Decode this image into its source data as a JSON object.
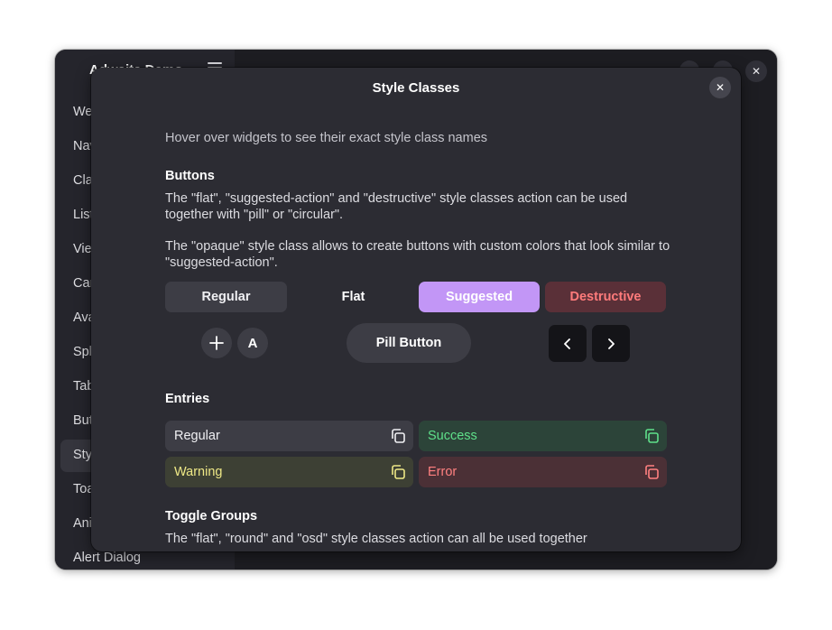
{
  "background_window": {
    "sidebar_title": "Adwaita Demo",
    "sidebar_items": [
      "Welcome",
      "Navigation View",
      "Clamp",
      "Lists",
      "View Switcher",
      "Carousel",
      "Avatar",
      "Split Views",
      "Tab View",
      "Buttons",
      "Style Classes",
      "Toasts",
      "Animations",
      "Alert Dialog"
    ],
    "selected_index": 10,
    "close_label": "✕"
  },
  "dialog": {
    "title": "Style Classes",
    "close_label": "✕",
    "hint": "Hover over widgets to see their exact style class names",
    "buttons_section": {
      "title": "Buttons",
      "para1": "The \"flat\", \"suggested-action\" and \"destructive\" style classes action can be used together with \"pill\" or \"circular\".",
      "para2": "The \"opaque\" style class allows to create buttons with custom colors that look similar to \"suggested-action\".",
      "regular": "Regular",
      "flat": "Flat",
      "suggested": "Suggested",
      "destructive": "Destructive",
      "circular_plus": "+",
      "circular_a": "A",
      "pill": "Pill Button"
    },
    "entries_section": {
      "title": "Entries",
      "regular": "Regular",
      "success": "Success",
      "warning": "Warning",
      "error": "Error"
    },
    "toggle_section": {
      "title": "Toggle Groups",
      "para": "The \"flat\", \"round\" and \"osd\" style classes action can all be used together"
    }
  },
  "colors": {
    "accent": "#c296f6",
    "destructive_text": "#ff7b7b",
    "success_text": "#5fe08a",
    "warning_text": "#eee886",
    "error_text": "#ff8080"
  }
}
